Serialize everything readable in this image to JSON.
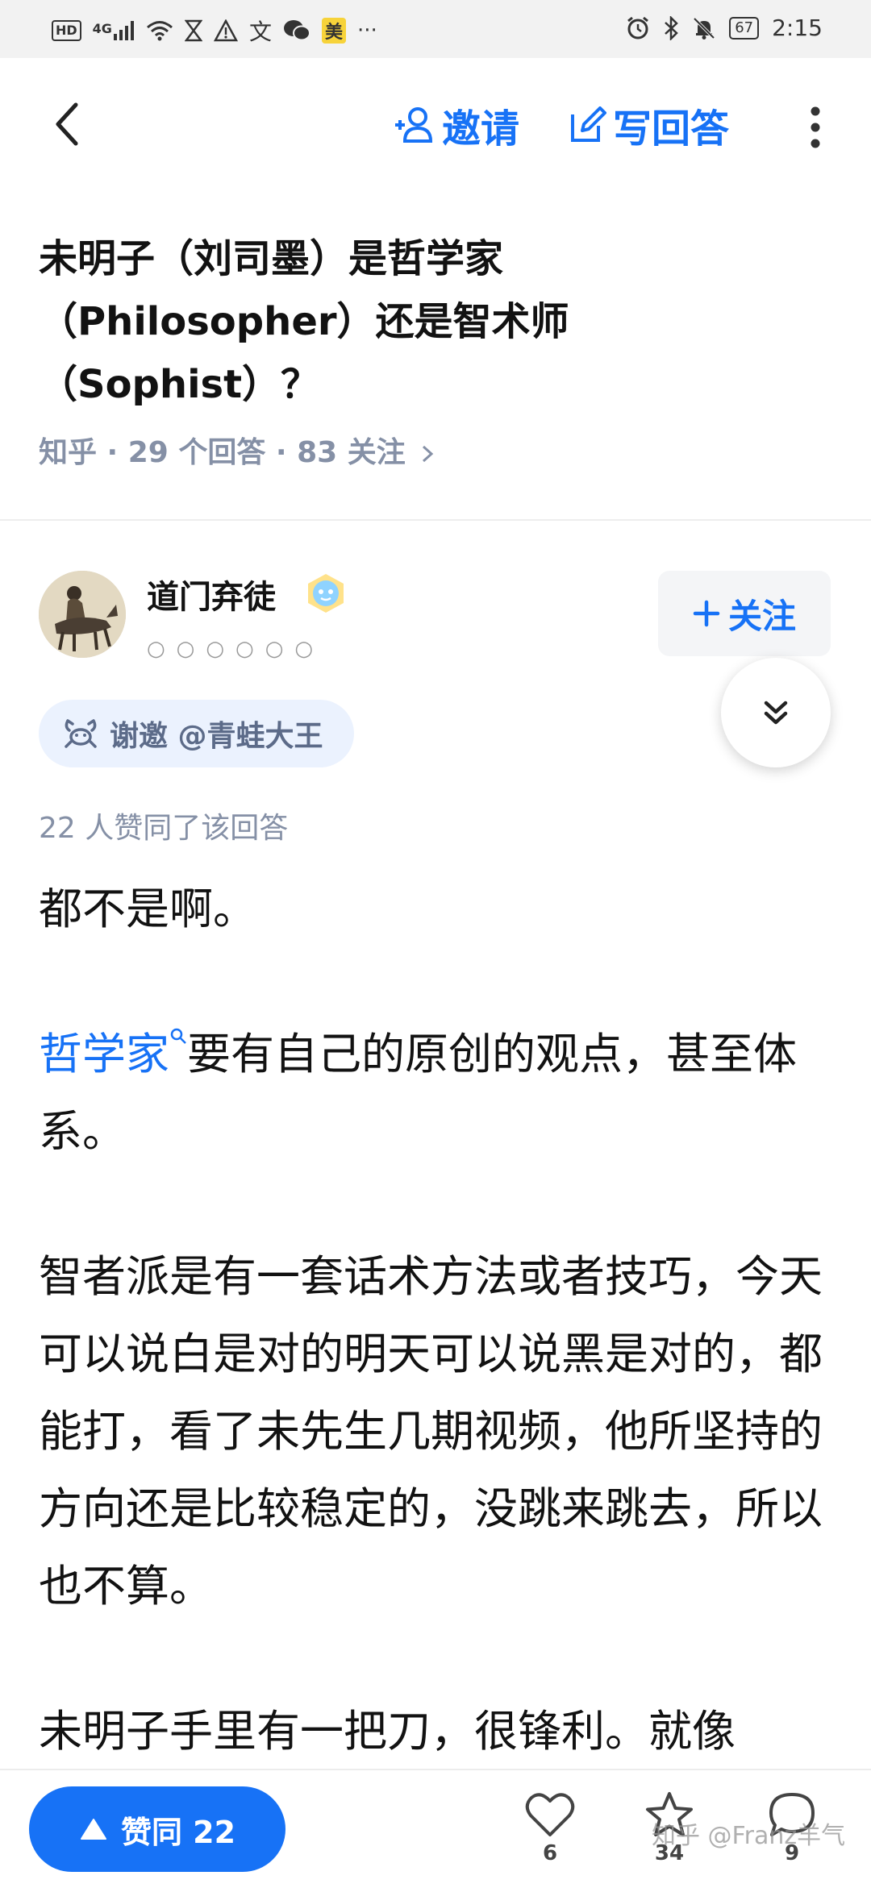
{
  "status_bar": {
    "hd": "HD",
    "net": "4G",
    "app_badge": "美",
    "more": "···",
    "battery": "67",
    "time": "2:15"
  },
  "nav": {
    "invite_label": "邀请",
    "write_label": "写回答"
  },
  "question": {
    "title_line1": "未明子（刘司墨）是哲学家",
    "title_line2": "（Philosopher）还是智术师",
    "title_line3": "（Sophist）？",
    "meta": "知乎 · 29 个回答 · 83 关注"
  },
  "answer": {
    "author_name": "道门弃徒",
    "author_bio_dots": "○○○○○○",
    "follow_label": "关注",
    "invite_tag": "谢邀 @青蛙大王",
    "likes_line": "22 人赞同了该回答",
    "p1": "都不是啊。",
    "p2_link": "哲学家",
    "p2_rest": "要有自己的原创的观点，甚至体系。",
    "p3": "智者派是有一套话术方法或者技巧，今天可以说白是对的明天可以说黑是对的，都能打，看了未先生几期视频，他所坚持的方向还是比较稳定的，没跳来跳去，所以也不算。",
    "p4": "未明子手里有一把刀，很锋利。就像"
  },
  "bottom": {
    "agree_label": "赞同 22",
    "like_count": "6",
    "fav_count": "34",
    "comment_count": "9",
    "watermark": "知乎 @Franz羊气"
  },
  "colors": {
    "accent": "#1772f6",
    "meta_gray": "#8590a6"
  }
}
